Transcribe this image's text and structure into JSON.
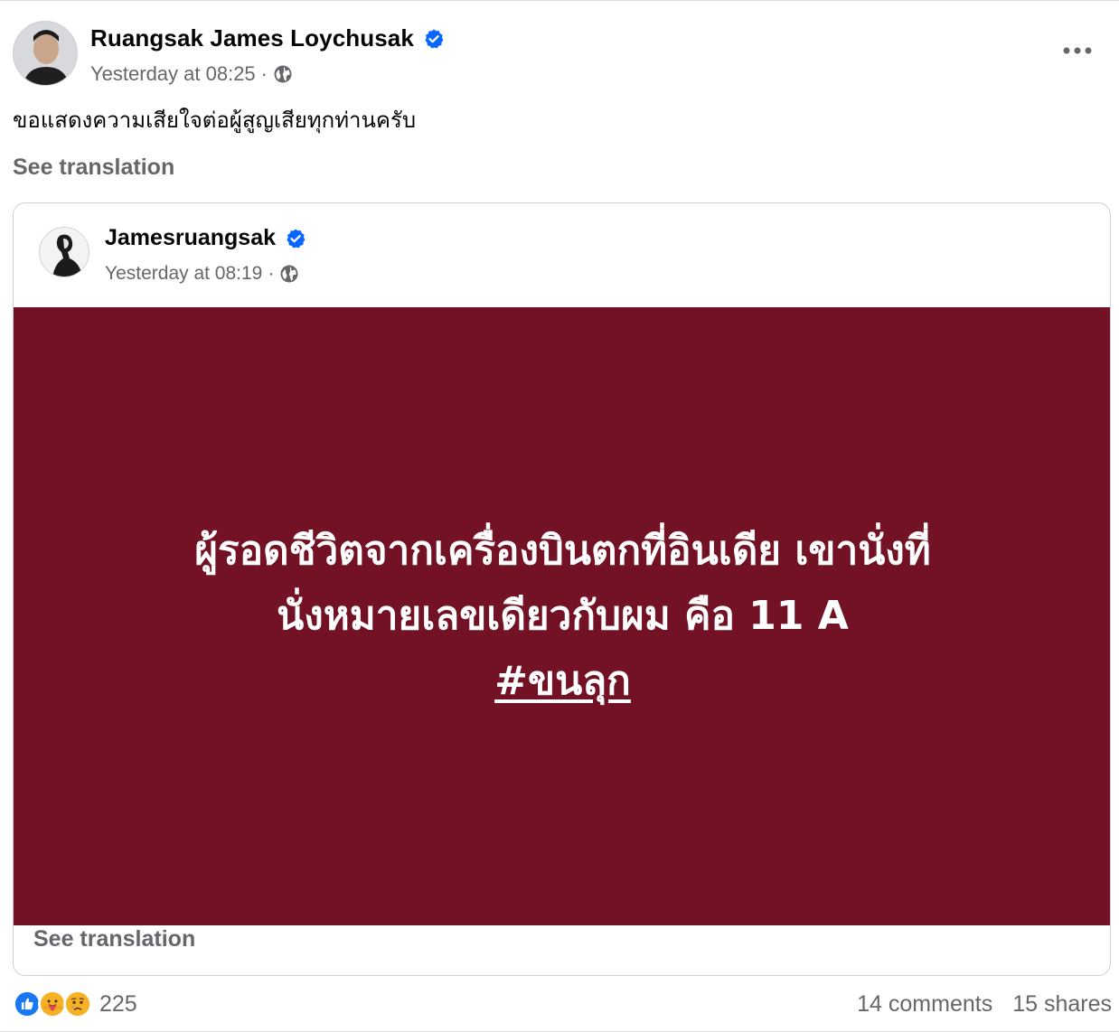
{
  "post": {
    "author": "Ruangsak James Loychusak",
    "timestamp": "Yesterday at 08:25",
    "separator": "·",
    "privacy_icon": "globe-icon",
    "more_icon": "more-options-icon",
    "text": "ขอแสดงความเสียใจต่อผู้สูญเสียทุกท่านครับ",
    "see_translation": "See translation"
  },
  "shared": {
    "author": "Jamesruangsak",
    "timestamp": "Yesterday at 08:19",
    "separator": "·",
    "privacy_icon": "globe-icon",
    "background_color": "#721224",
    "line1": "ผู้รอดชีวิตจากเครื่องบินตกที่อินเดีย เขานั่งที่",
    "line2": "นั่งหมายเลขเดียวกับผม คือ 11 A",
    "hashtag": "#ขนลุก",
    "see_translation": "See translation"
  },
  "footer": {
    "reactions": [
      "like",
      "care",
      "sad"
    ],
    "reaction_count": "225",
    "comments": "14 comments",
    "shares": "15 shares"
  },
  "colors": {
    "verified": "#0866ff",
    "secondary_text": "#65676b"
  }
}
